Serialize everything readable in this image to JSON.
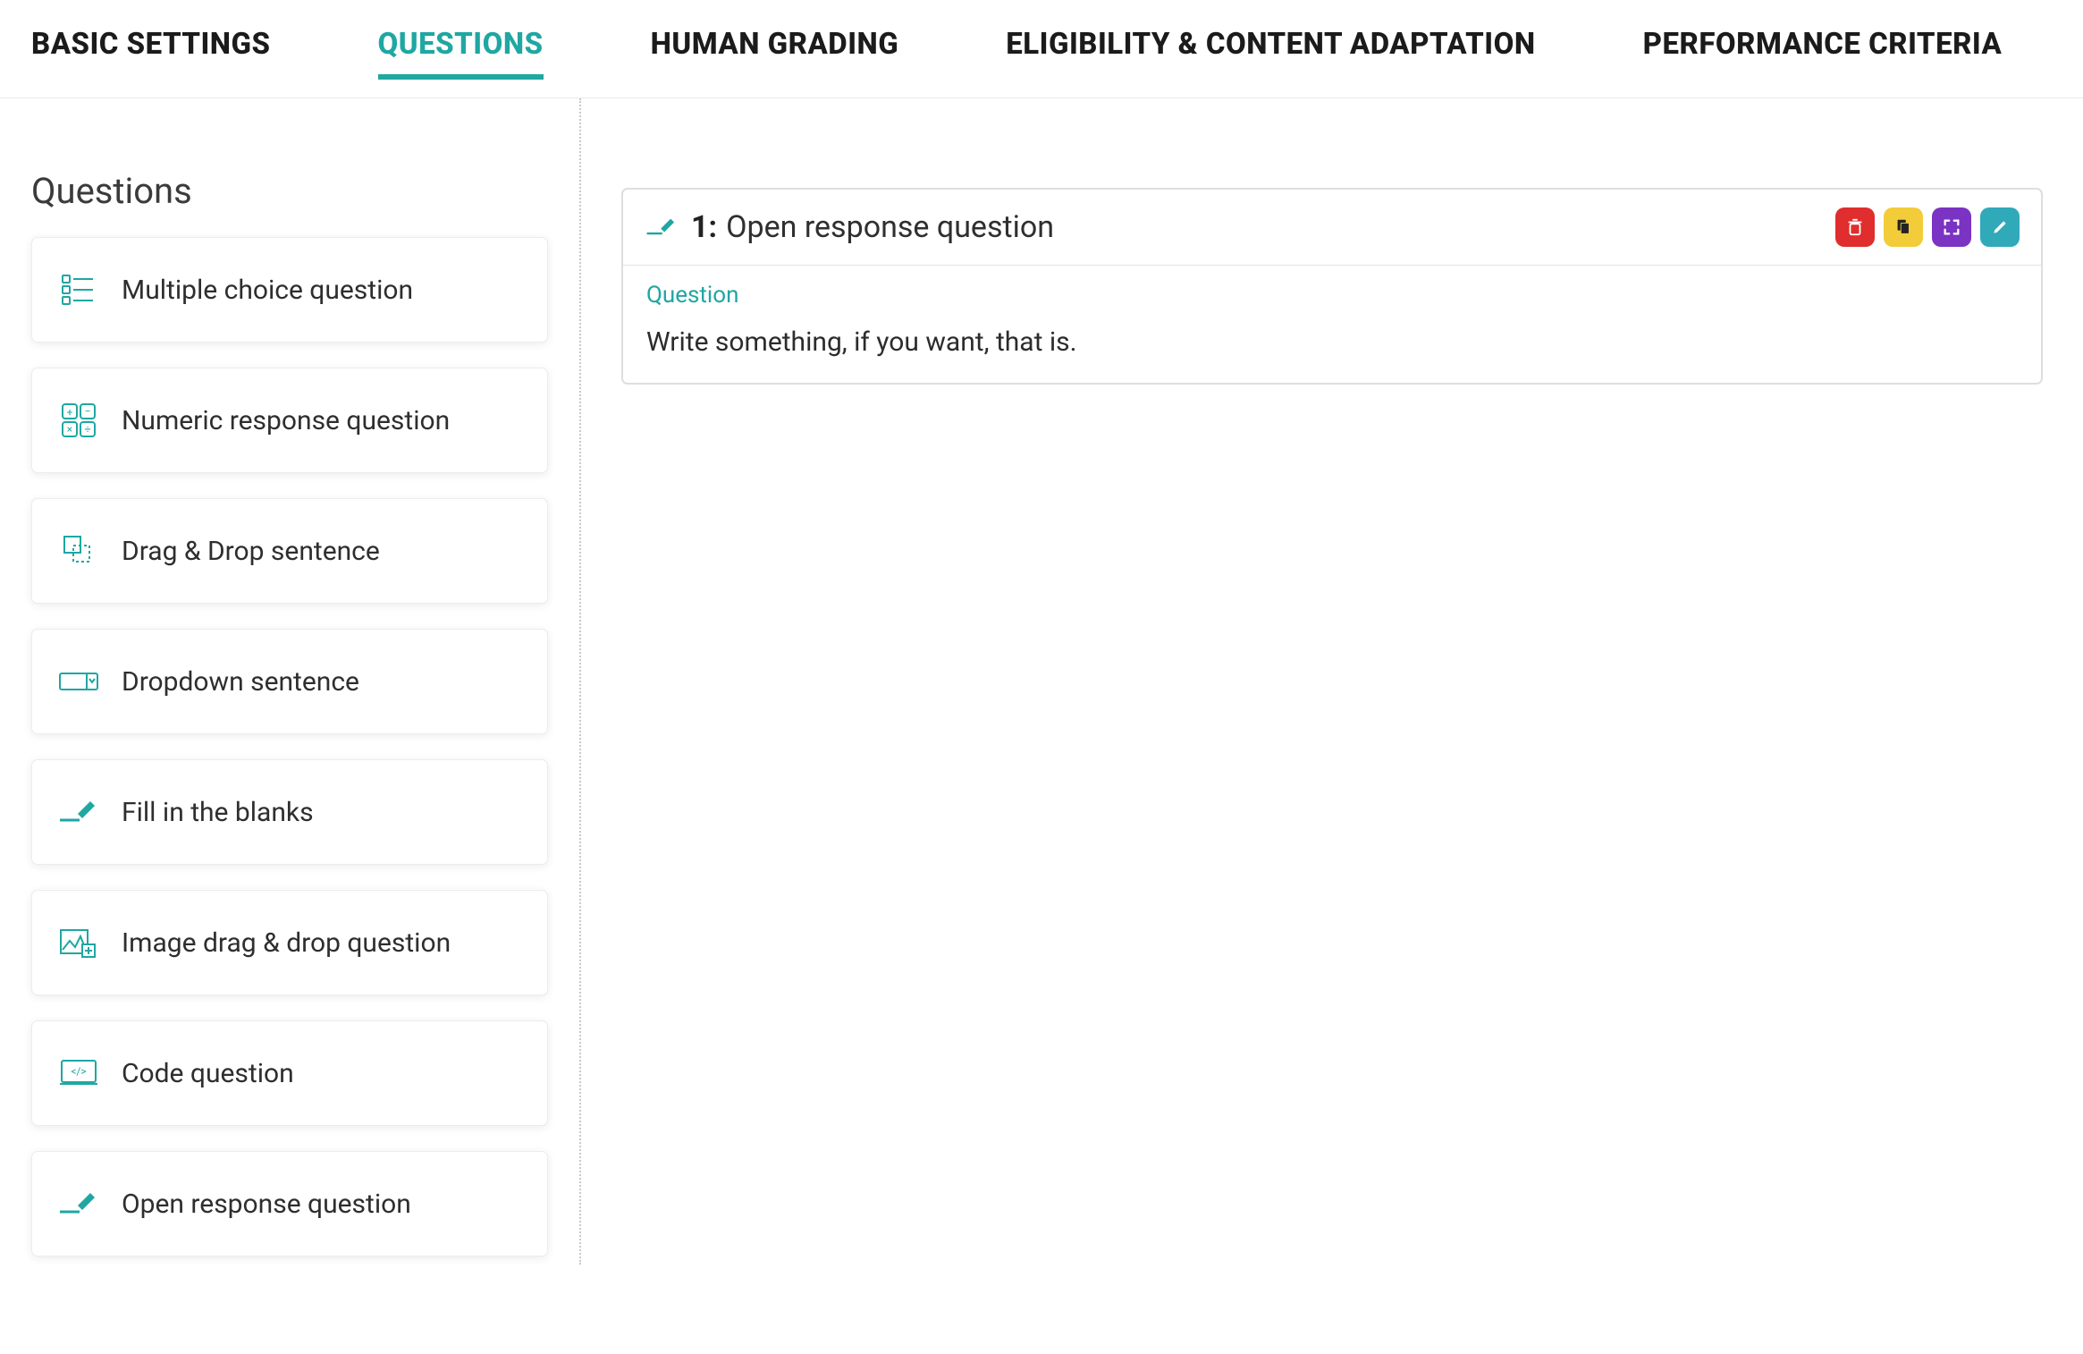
{
  "tabs": [
    {
      "id": "basic",
      "label": "BASIC SETTINGS",
      "active": false
    },
    {
      "id": "questions",
      "label": "QUESTIONS",
      "active": true
    },
    {
      "id": "human",
      "label": "HUMAN GRADING",
      "active": false
    },
    {
      "id": "eligibility",
      "label": "ELIGIBILITY & CONTENT ADAPTATION",
      "active": false
    },
    {
      "id": "performance",
      "label": "PERFORMANCE CRITERIA",
      "active": false
    }
  ],
  "sidebar": {
    "heading": "Questions",
    "items": [
      {
        "icon": "multiple-choice-icon",
        "label": "Multiple choice question"
      },
      {
        "icon": "numeric-icon",
        "label": "Numeric response question"
      },
      {
        "icon": "drag-drop-icon",
        "label": "Drag & Drop sentence"
      },
      {
        "icon": "dropdown-icon",
        "label": "Dropdown sentence"
      },
      {
        "icon": "fill-blanks-icon",
        "label": "Fill in the blanks"
      },
      {
        "icon": "image-drag-icon",
        "label": "Image drag & drop question"
      },
      {
        "icon": "code-icon",
        "label": "Code question"
      },
      {
        "icon": "open-response-icon",
        "label": "Open response question"
      }
    ]
  },
  "question": {
    "number": "1:",
    "title": "Open response question",
    "section_label": "Question",
    "text": "Write something, if you want, that is."
  },
  "colors": {
    "accent": "#1FA7A2",
    "delete": "#e02d2d",
    "copy": "#f3cc3a",
    "expand": "#7a33c2",
    "edit": "#30a9b9"
  }
}
